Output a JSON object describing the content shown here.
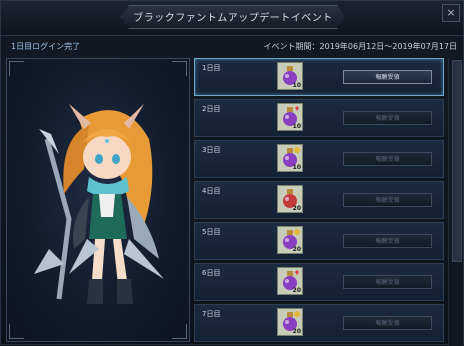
{
  "window": {
    "title": "ブラックファントムアップデートイベント",
    "close_glyph": "×"
  },
  "status": {
    "login_text": "1日目ログイン完了",
    "period_text": "イベント期間：2019年06月12日～2019年07月17日"
  },
  "rewards": [
    {
      "day": "1日目",
      "qty": "10",
      "icon": "purple-potion-icon",
      "button": "報酬受領",
      "active": true
    },
    {
      "day": "2日目",
      "qty": "10",
      "icon": "purple-potion-heart-icon",
      "button": "報酬受領",
      "active": false
    },
    {
      "day": "3日目",
      "qty": "10",
      "icon": "purple-potion-gold-icon",
      "button": "報酬受領",
      "active": false
    },
    {
      "day": "4日目",
      "qty": "20",
      "icon": "red-potion-icon",
      "button": "報酬受領",
      "active": false
    },
    {
      "day": "5日目",
      "qty": "20",
      "icon": "purple-potion-gold-icon",
      "button": "報酬受領",
      "active": false
    },
    {
      "day": "6日目",
      "qty": "20",
      "icon": "purple-potion-heart-icon",
      "button": "報酬受領",
      "active": false
    },
    {
      "day": "7日目",
      "qty": "20",
      "icon": "purple-potion-gold-icon",
      "button": "報酬受領",
      "active": false
    }
  ]
}
